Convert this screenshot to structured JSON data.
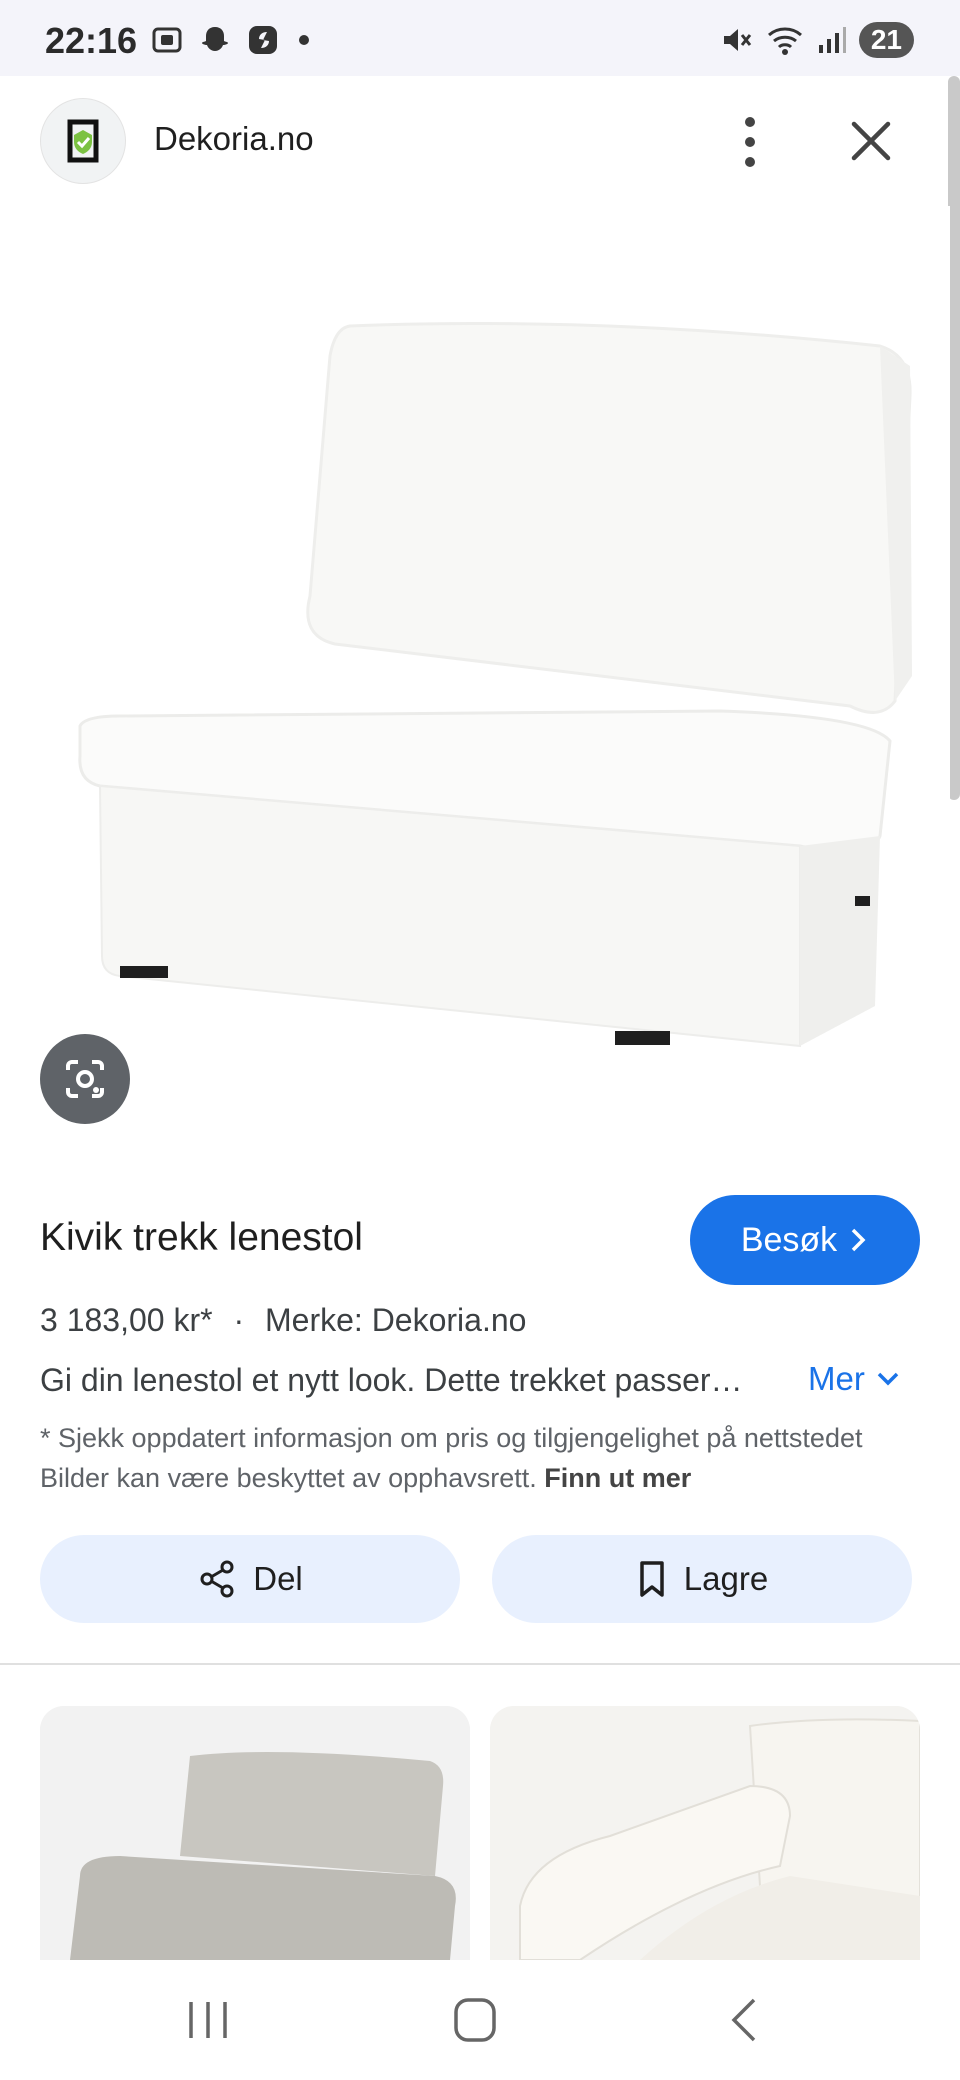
{
  "status_bar": {
    "time": "22:16",
    "battery": "21",
    "icons": [
      "screenshot-icon",
      "snapchat-icon",
      "app-icon",
      "dot-icon",
      "mute-icon",
      "wifi-icon",
      "signal-icon"
    ]
  },
  "header": {
    "site_name": "Dekoria.no",
    "logo_color": "#7cc242"
  },
  "product": {
    "title": "Kivik trekk lenestol",
    "visit_label": "Besøk",
    "price": "3 183,00 kr*",
    "separator": "·",
    "brand": "Merke: Dekoria.no",
    "description": "Gi din lenestol et nytt look. Dette trekket passer…",
    "more_label": "Mer",
    "disclaimer": "* Sjekk oppdatert informasjon om pris og tilgjengelighet på nettstedet Bilder kan være beskyttet av opphavsrett.",
    "learn_more": "Finn ut mer"
  },
  "actions": {
    "share_label": "Del",
    "save_label": "Lagre"
  },
  "colors": {
    "accent": "#1a73e8",
    "chip_bg": "#e8f0fe"
  }
}
